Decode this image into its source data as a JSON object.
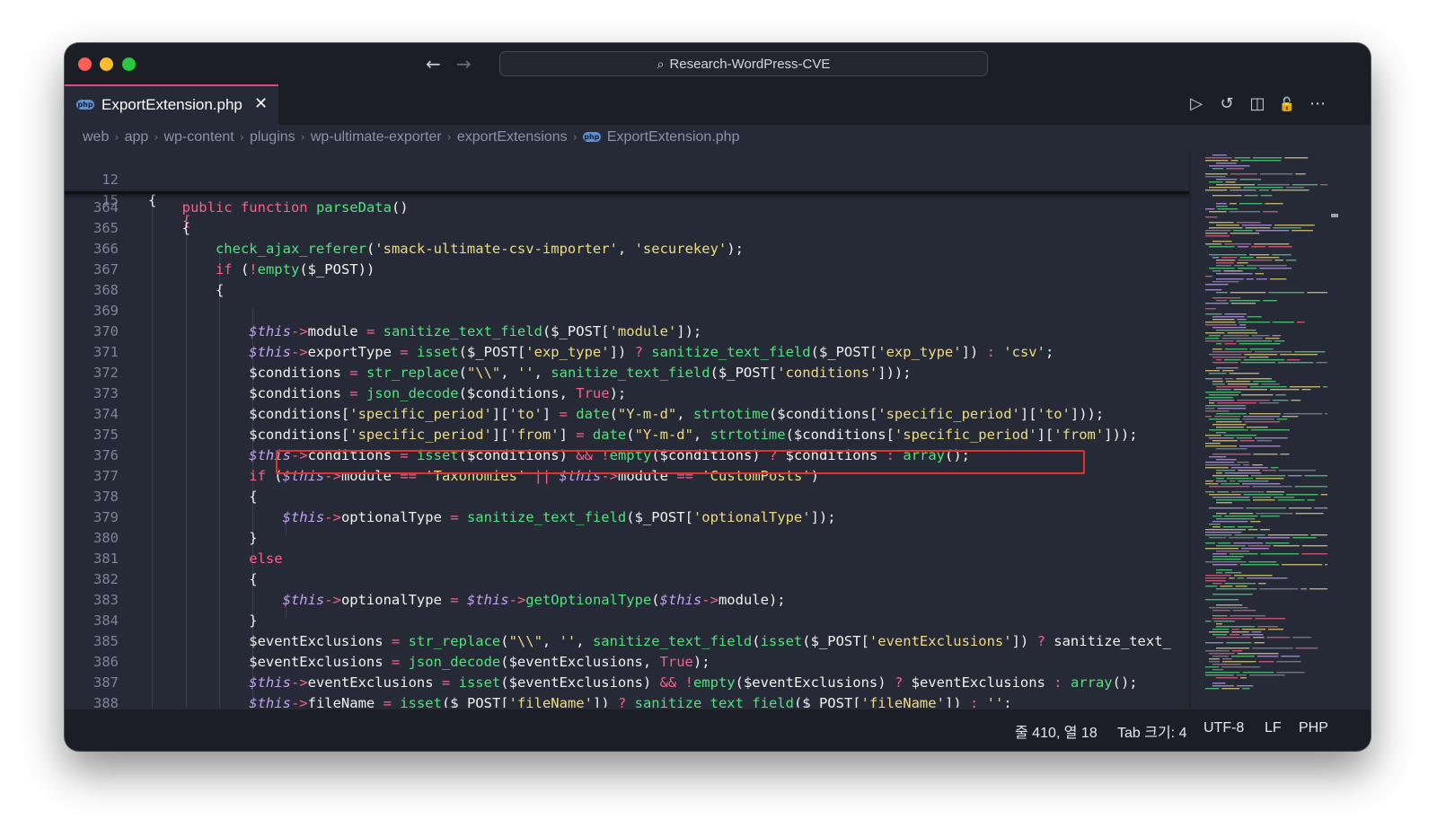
{
  "window": {
    "search_text": "Research-WordPress-CVE",
    "nav_back": "←",
    "nav_forward": "→"
  },
  "tab": {
    "filename": "ExportExtension.php",
    "badge": "php",
    "close": "✕"
  },
  "toolbar": {
    "run": "▷",
    "history": "↺",
    "split": "◫",
    "lock": "🔓",
    "more": "⋯"
  },
  "breadcrumb": [
    "web",
    "app",
    "wp-content",
    "plugins",
    "wp-ultimate-exporter",
    "exportExtensions",
    "ExportExtension.php"
  ],
  "code": {
    "sticky": [
      {
        "n": "12",
        "text": "{"
      },
      {
        "n": "15",
        "text": "{"
      }
    ],
    "lines": [
      {
        "n": "364",
        "text": "public function parseData()"
      },
      {
        "n": "365",
        "text": "{"
      },
      {
        "n": "366",
        "text": "check_ajax_referer('smack-ultimate-csv-importer', 'securekey');"
      },
      {
        "n": "367",
        "text": "if (!empty($_POST))"
      },
      {
        "n": "368",
        "text": "{"
      },
      {
        "n": "369",
        "text": ""
      },
      {
        "n": "370",
        "text": "$this->module = sanitize_text_field($_POST['module']);"
      },
      {
        "n": "371",
        "text": "$this->exportType = isset($_POST['exp_type']) ? sanitize_text_field($_POST['exp_type']) : 'csv';"
      },
      {
        "n": "372",
        "text": "$conditions = str_replace(\"\\\\\", '', sanitize_text_field($_POST['conditions']));"
      },
      {
        "n": "373",
        "text": "$conditions = json_decode($conditions, True);"
      },
      {
        "n": "374",
        "text": "$conditions['specific_period']['to'] = date(\"Y-m-d\", strtotime($conditions['specific_period']['to']));"
      },
      {
        "n": "375",
        "text": "$conditions['specific_period']['from'] = date(\"Y-m-d\", strtotime($conditions['specific_period']['from']));"
      },
      {
        "n": "376",
        "text": "$this->conditions = isset($conditions) && !empty($conditions) ? $conditions : array();"
      },
      {
        "n": "377",
        "text": "if ($this->module == 'Taxonomies' || $this->module == 'CustomPosts')"
      },
      {
        "n": "378",
        "text": "{"
      },
      {
        "n": "379",
        "text": "$this->optionalType = sanitize_text_field($_POST['optionalType']);"
      },
      {
        "n": "380",
        "text": "}"
      },
      {
        "n": "381",
        "text": "else"
      },
      {
        "n": "382",
        "text": "{"
      },
      {
        "n": "383",
        "text": "$this->optionalType = $this->getOptionalType($this->module);"
      },
      {
        "n": "384",
        "text": "}"
      },
      {
        "n": "385",
        "text": "$eventExclusions = str_replace(\"\\\\\", '', sanitize_text_field(isset($_POST['eventExclusions']) ? sanitize_text_"
      },
      {
        "n": "386",
        "text": "$eventExclusions = json_decode($eventExclusions, True);"
      },
      {
        "n": "387",
        "text": "$this->eventExclusions = isset($eventExclusions) && !empty($eventExclusions) ? $eventExclusions : array();"
      },
      {
        "n": "388",
        "text": "$this->fileName = isset($_POST['fileName']) ? sanitize_text_field($_POST['fileName']) : '';"
      }
    ]
  },
  "status": {
    "position": "줄 410, 열 18",
    "tab_size": "Tab 크기: 4",
    "encoding": "UTF-8",
    "eol": "LF",
    "language": "PHP"
  },
  "colors": {
    "keyword": "#f7618c",
    "function": "#52e27e",
    "string": "#eedc82",
    "this": "#c4a3f2",
    "highlight_box": "#e2332b"
  }
}
